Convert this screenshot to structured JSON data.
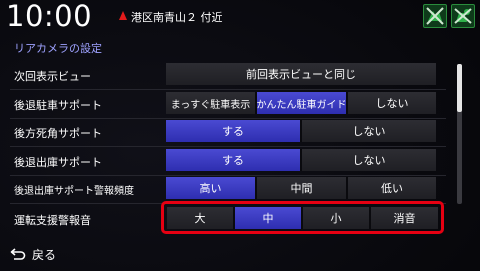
{
  "header": {
    "time": "10:00",
    "location": "港区南青山２ 付近",
    "icons": [
      "gps-off-icon",
      "signal-status-icon"
    ]
  },
  "screen": {
    "title": "リアカメラの設定"
  },
  "settings": {
    "next_view": {
      "label": "次回表示ビュー",
      "value": "前回表示ビューと同じ"
    },
    "reverse_parking": {
      "label": "後退駐車サポート",
      "options": [
        "まっすぐ駐車表示",
        "かんたん駐車ガイド",
        "しない"
      ],
      "selected": "かんたん駐車ガイド"
    },
    "rear_blindspot": {
      "label": "後方死角サポート",
      "options": [
        "する",
        "しない"
      ],
      "selected": "する"
    },
    "reverse_exit": {
      "label": "後退出庫サポート",
      "options": [
        "する",
        "しない"
      ],
      "selected": "する"
    },
    "reverse_exit_alert_freq": {
      "label": "後退出庫サポート警報頻度",
      "options": [
        "高い",
        "中間",
        "低い"
      ],
      "selected": "高い"
    },
    "driving_assist_alert_sound": {
      "label": "運転支援警報音",
      "options": [
        "大",
        "中",
        "小",
        "消音"
      ],
      "selected": "中"
    }
  },
  "footer": {
    "back_label": "戻る"
  },
  "colors": {
    "selected": "#3b3bc4",
    "unselected": "#26262b",
    "title": "#9ea2ff",
    "highlight": "#e60012",
    "gps_icon": "#2a8c3c"
  }
}
